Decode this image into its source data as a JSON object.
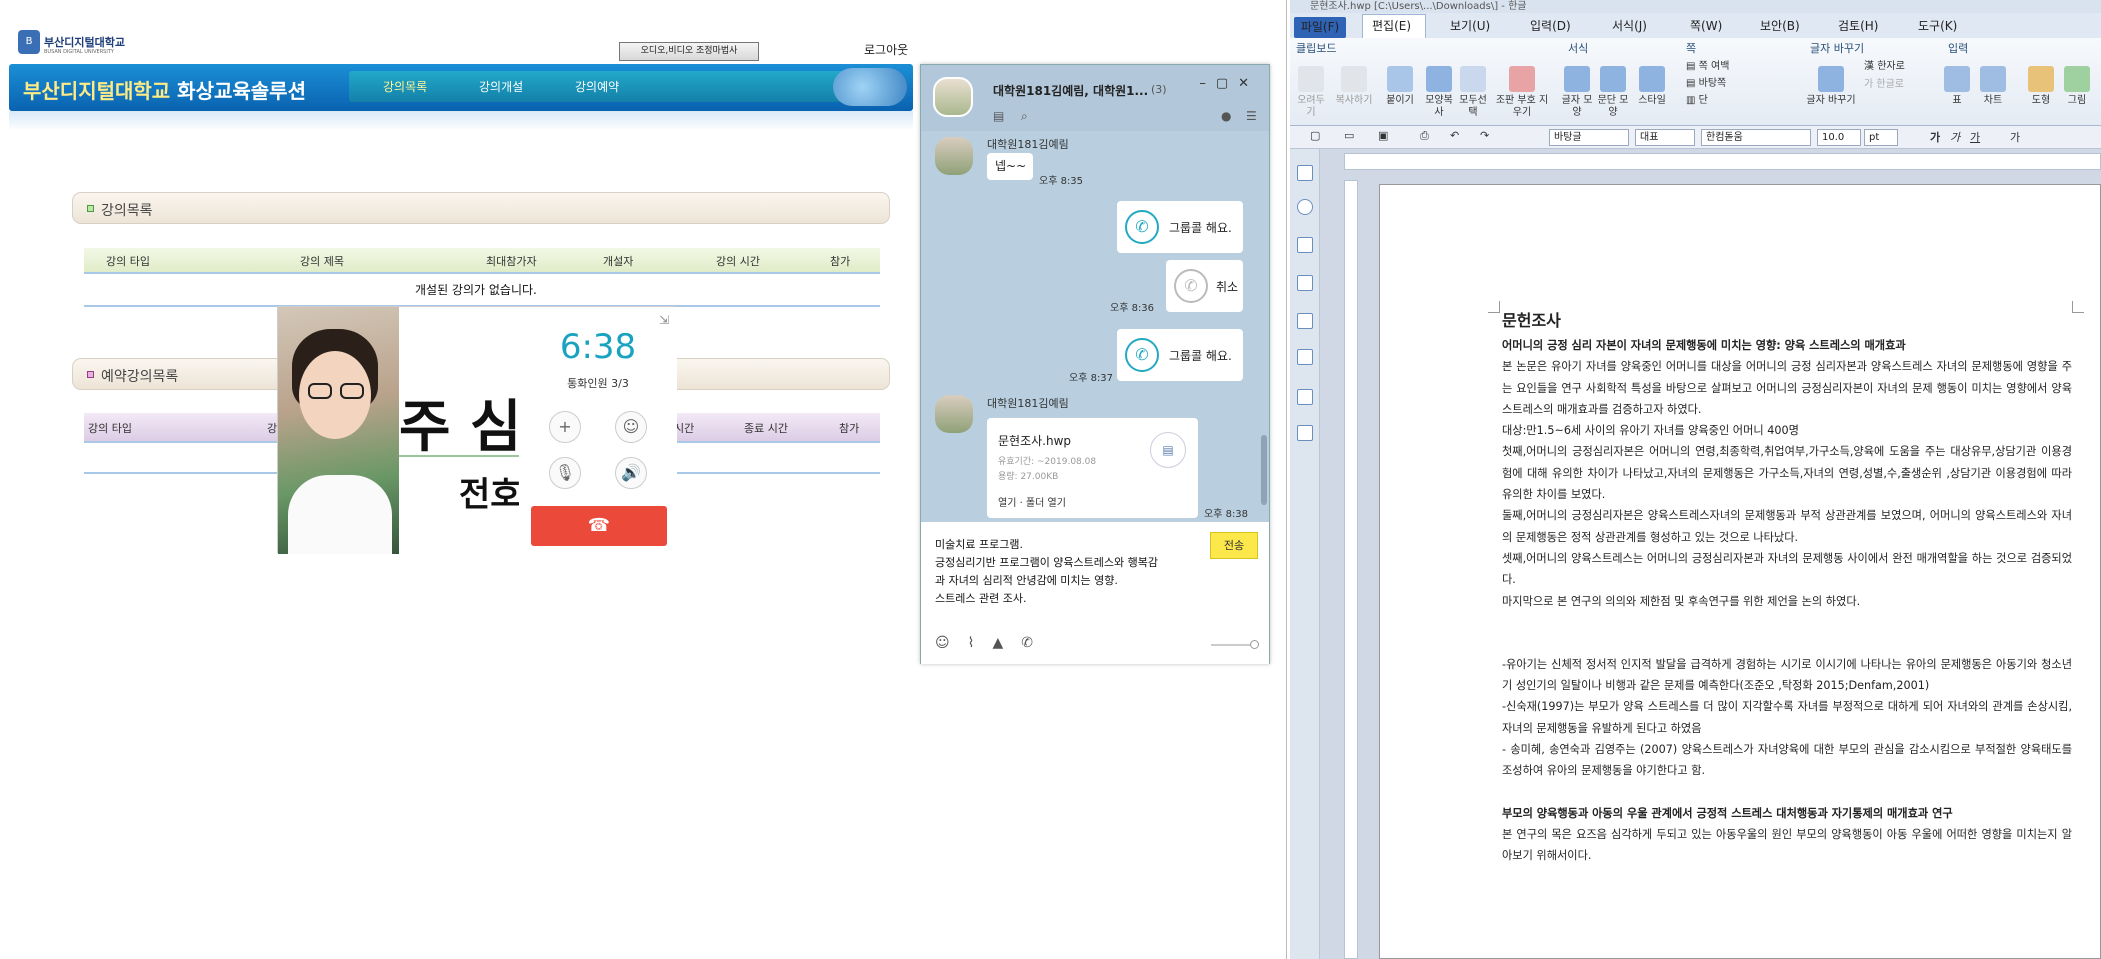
{
  "left_panel": {
    "logo_text": "부산디지털대학교",
    "logo_sub": "BUSAN DIGITAL UNIVERSITY",
    "av_button": "오디오,비디오 조정마법사",
    "logout": "로그아웃",
    "banner_title_a": "부산디지털대학교",
    "banner_title_b": "화상교육솔루션",
    "menu": [
      "강의목록",
      "강의개설",
      "강의예약"
    ],
    "section1": "강의목록",
    "section1_cols": [
      "강의 타입",
      "강의 제목",
      "최대참가자",
      "개설자",
      "강의 시간",
      "참가"
    ],
    "empty_msg": "개설된 강의가 없습니다.",
    "section2": "예약강의목록",
    "section2_cols": [
      "강의 타입",
      "강",
      "시간",
      "종료 시간",
      "참가"
    ]
  },
  "video_call": {
    "time": "6:38",
    "participants": "통화인원 3/3",
    "shared_big": "주 심",
    "shared_big2": "전호"
  },
  "chat": {
    "title": "대학원181김예림, 대학원1...",
    "count": "(3)",
    "sender_top": "대학원181김예림",
    "msg1": "넵~~",
    "time1": "오후 8:35",
    "call_bubble1": "그룹콜 해요.",
    "cancel_bubble": "취소",
    "time2": "오후 8:36",
    "call_bubble2": "그룹콜 해요.",
    "time3": "오후 8:37",
    "sender2": "대학원181김예림",
    "file_name": "문현조사.hwp",
    "file_exp": "유효기간: ~2019.08.08",
    "file_size": "용량: 27.00KB",
    "file_actions": "열기 · 폴더 열기",
    "time4": "오후 8:38",
    "input_text": "미술치료 프로그램.\n긍정심리기반 프로그램이 양육스트레스와 행복감\n과 자녀의 심리적 안녕감에 미치는 영향.\n스트레스 관련 조사.",
    "send": "전송"
  },
  "hwp": {
    "title": "문현조사.hwp [C:\\Users\\...\\Downloads\\] - 한글",
    "menu": [
      "파일(F)",
      "편집(E)",
      "보기(U)",
      "입력(D)",
      "서식(J)",
      "쪽(W)",
      "보안(B)",
      "검토(H)",
      "도구(K)"
    ],
    "groups": [
      "클립보드",
      "서식",
      "쪽",
      "글자 바꾸기",
      "입력"
    ],
    "buttons": [
      "오려두기",
      "복사하기",
      "붙이기",
      "모양복사",
      "모두선택",
      "조판 부호 지우기",
      "글자 모양",
      "문단 모양",
      "스타일",
      "쪽 여백",
      "바탕쪽",
      "단",
      "글자 바꾸기",
      "한자로",
      "한글로",
      "표",
      "차트",
      "도형",
      "그림"
    ],
    "style_combo": "바탕글",
    "lang_combo": "대표",
    "font_combo": "한컴돋움",
    "size_combo": "10.0",
    "unit": "pt",
    "doc": {
      "title": "문헌조사",
      "h1": "어머니의 긍정 심리 자본이 자녀의 문제행동에 미치는 영향: 양육 스트레스의 매개효과",
      "p1": "본 논문은 유아기 자녀를 양육중인 어머니를 대상을 어머니의 긍정 심리자본과 양육스트레스 자녀의 문제행동에 영향을 주는 요인들을 연구 사회학적 특성을 바탕으로 살펴보고 어머니의 긍정심리자본이 자녀의 문제 행동이 미치는 영향에서 양육 스트레스의 매개효과를 검증하고자 하였다.",
      "p2": "대상:만1.5~6세 사이의 유아기 자녀를 양육중인 어머니 400명",
      "p3": "첫째,어머니의 긍정심리자본은 어머니의 연령,최종학력,취업여부,가구소득,양육에 도움을 주는 대상유무,상담기관 이용경험에 대해 유의한 차이가 나타났고,자녀의 문제행동은 가구소득,자녀의 연령,성별,수,출생순위 ,상담기관 이용경험에 따라 유의한 차이를 보였다.",
      "p4": "둘째,어머니의 긍정심리자본은 양육스트레스자녀의 문제행동과 부적 상관관계를 보였으며, 어머니의 양육스트레스와 자녀의 문제행동은 정적 상관관계를 형성하고 있는 것으로 나타났다.",
      "p5": "셋째,어머니의 양육스트레스는 어머니의 긍정심리자본과 자녀의 문제행동 사이에서 완전 매개역할을 하는 것으로 검증되었다.",
      "p6": "마지막으로 본 연구의 의의와 제한점 및 후속연구를 위한 제언을 논의 하였다.",
      "p7": "-유아기는 신체적 정서적 인지적 발달을 급격하게 경험하는 시기로 이시기에 나타나는 유아의 문제행동은 아동기와 청소년기 성인기의 일탈이나 비행과 같은 문제를 예측한다(조준오 ,탁정화 2015;Denfam,2001)",
      "p8": "-신숙재(1997)는 부모가 양육 스트레스를 더 많이 지각할수록 자녀를 부정적으로 대하게 되어 자녀와의 관계를 손상시킴,자녀의 문제행동을 유발하게 된다고 하였음",
      "p9": "- 송미혜, 송연숙과 김영주는 (2007) 양육스트레스가 자녀양육에 대한 부모의 관심을 감소시킴으로 부적절한 양육태도를 조성하여 유아의 문제행동을 야기한다고 함.",
      "h2": "부모의 양육행동과 아동의 우울 관계에서 긍정적 스트레스 대처행동과 자기통제의 매개효과 연구",
      "p10": "본 연구의 목은 요즈음 심각하게 두되고 있는 아동우울의 원인 부모의 양육행동이 아동 우울에 어떠한 영향을 미치는지 알아보기 위해서이다."
    }
  },
  "colors": {
    "banner": "#0a62b0",
    "call_accent": "#1aa3c0",
    "end_call": "#eb4a3b",
    "send_button": "#fce84a",
    "hwp_file_tab": "#2f63b5"
  }
}
